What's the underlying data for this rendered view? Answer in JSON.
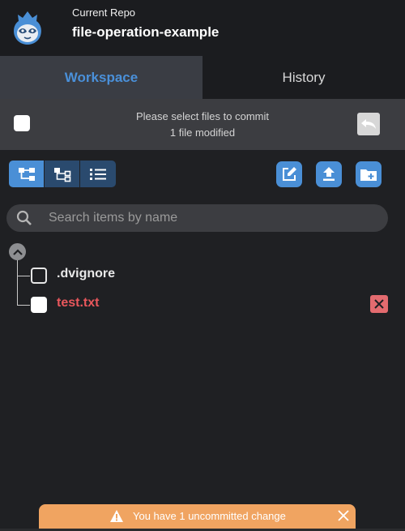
{
  "header": {
    "repo_label": "Current Repo",
    "repo_name": "file-operation-example"
  },
  "tabs": [
    {
      "label": "Workspace",
      "active": true
    },
    {
      "label": "History",
      "active": false
    }
  ],
  "commit_bar": {
    "line1": "Please select files to commit",
    "line2": "1 file modified"
  },
  "search": {
    "placeholder": "Search items by name",
    "value": ""
  },
  "files": [
    {
      "name": ".dvignore",
      "status": "normal",
      "checked": false
    },
    {
      "name": "test.txt",
      "status": "modified",
      "checked": true
    }
  ],
  "toast": {
    "message": "You have 1 uncommitted change"
  },
  "colors": {
    "accent": "#4a8fd6",
    "modified": "#e9575c",
    "warning": "#f0a461",
    "background": "#1f2023"
  },
  "icons": {
    "logo": "sloth-logo",
    "undo": "undo-icon",
    "tree_view": "tree-view-icon",
    "tree_view_alt": "tree-view-alt-icon",
    "list_view": "list-view-icon",
    "edit": "edit-icon",
    "upload": "upload-icon",
    "add_folder": "folder-add-icon",
    "search": "search-icon",
    "collapse": "chevron-up-icon",
    "remove": "close-icon",
    "warning": "warning-icon"
  }
}
